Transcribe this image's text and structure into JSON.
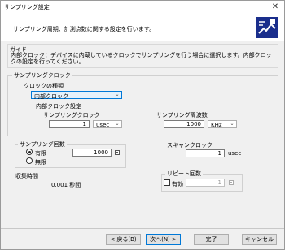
{
  "window": {
    "title": "サンプリング設定"
  },
  "header": {
    "description": "サンプリング周期、計測点数に関する設定を行います。"
  },
  "guide": {
    "title": "ガイド",
    "text": "内部クロック：デバイスに内蔵しているクロックでサンプリングを行う場合に選択します。内部クロックの設定を行ってください。"
  },
  "sampling_clock": {
    "title": "サンプリングクロック",
    "clock_type_label": "クロックの種類",
    "clock_type_value": "内部クロック",
    "internal_settings_label": "内部クロック設定",
    "clock_label": "サンプリングクロック",
    "clock_value": "1",
    "clock_unit": "usec",
    "frequency_label": "サンプリング周波数",
    "frequency_value": "1000",
    "frequency_unit": "KHz"
  },
  "sampling_count": {
    "title": "サンプリング回数",
    "limited_label": "有限",
    "unlimited_label": "無限",
    "selected": "limited",
    "count_value": "1000"
  },
  "scan_clock": {
    "title": "スキャンクロック",
    "value": "1",
    "unit": "usec"
  },
  "collection_time": {
    "title": "収集時間",
    "value": "0.001 秒間"
  },
  "repeat": {
    "title": "リピート回数",
    "enable_label": "有効",
    "checked": false,
    "value": "1"
  },
  "buttons": {
    "back": "< 戻る(B)",
    "next": "次へ(N) >",
    "finish": "完了",
    "cancel": "キャンセル"
  }
}
